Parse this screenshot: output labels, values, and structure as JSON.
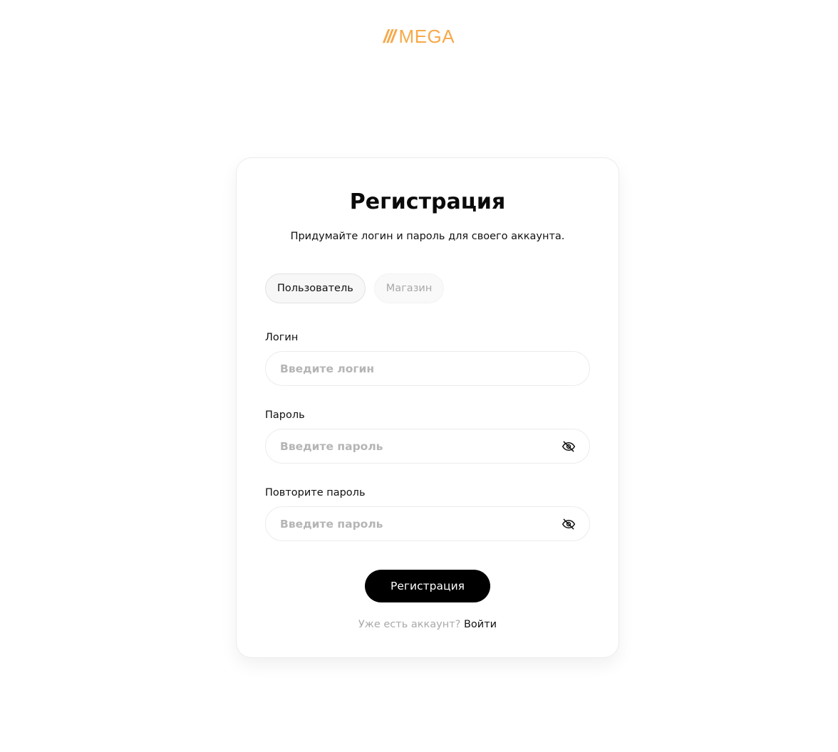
{
  "brand": {
    "slashes": "///",
    "name": "MEGA",
    "color": "#f6a94a"
  },
  "card": {
    "title": "Регистрация",
    "subtitle": "Придумайте логин и пароль для своего аккаунта."
  },
  "roles": {
    "user": "Пользователь",
    "shop": "Магазин",
    "selected": "Пользователь"
  },
  "fields": {
    "login": {
      "label": "Логин",
      "placeholder": "Введите логин",
      "value": ""
    },
    "password": {
      "label": "Пароль",
      "placeholder": "Введите пароль",
      "value": "",
      "icon": "eye-off-icon"
    },
    "password_repeat": {
      "label": "Повторите пароль",
      "placeholder": "Введите пароль",
      "value": "",
      "icon": "eye-off-icon"
    }
  },
  "actions": {
    "submit_label": "Регистрация",
    "has_account_text": "Уже есть аккаунт?",
    "login_link": "Войти"
  },
  "colors": {
    "primary_button": "#000000",
    "muted_text": "#a9a9a9"
  }
}
